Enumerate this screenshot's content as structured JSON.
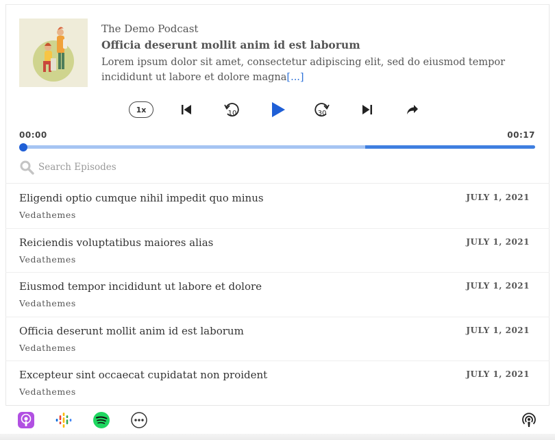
{
  "player": {
    "show_title": "The Demo Podcast",
    "episode_title": "Officia deserunt mollit anim id est laborum",
    "episode_description": "Lorem ipsum dolor sit amet, consectetur adipiscing elit, sed do eiusmod tempor incididunt ut labore et dolore magna",
    "read_more": "[...]",
    "speed_label": "1x",
    "current_time": "00:00",
    "duration": "00:17",
    "progress": 0.0,
    "buffered": 0.67,
    "accent_color": "#1f5fd6"
  },
  "controls": {
    "speed": "speed-icon",
    "previous": "skip-previous-icon",
    "rewind": "rewind-10-icon",
    "rewind_label": "10",
    "play": "play-icon",
    "forward": "forward-30-icon",
    "forward_label": "30",
    "next": "skip-next-icon",
    "share": "share-icon"
  },
  "search": {
    "placeholder": "Search Episodes"
  },
  "episodes": [
    {
      "title": "Eligendi optio cumque nihil impedit quo minus",
      "author": "Vedathemes",
      "date": "JULY 1, 2021"
    },
    {
      "title": "Reiciendis voluptatibus maiores alias",
      "author": "Vedathemes",
      "date": "JULY 1, 2021"
    },
    {
      "title": "Eiusmod tempor incididunt ut labore et dolore",
      "author": "Vedathemes",
      "date": "JULY 1, 2021"
    },
    {
      "title": "Officia deserunt mollit anim id est laborum",
      "author": "Vedathemes",
      "date": "JULY 1, 2021"
    },
    {
      "title": "Excepteur sint occaecat cupidatat non proident",
      "author": "Vedathemes",
      "date": "JULY 1, 2021"
    }
  ],
  "subscribe": {
    "icons": [
      "apple-podcasts-icon",
      "google-podcasts-icon",
      "spotify-icon",
      "more-options-icon",
      "podcast-feed-icon"
    ]
  }
}
